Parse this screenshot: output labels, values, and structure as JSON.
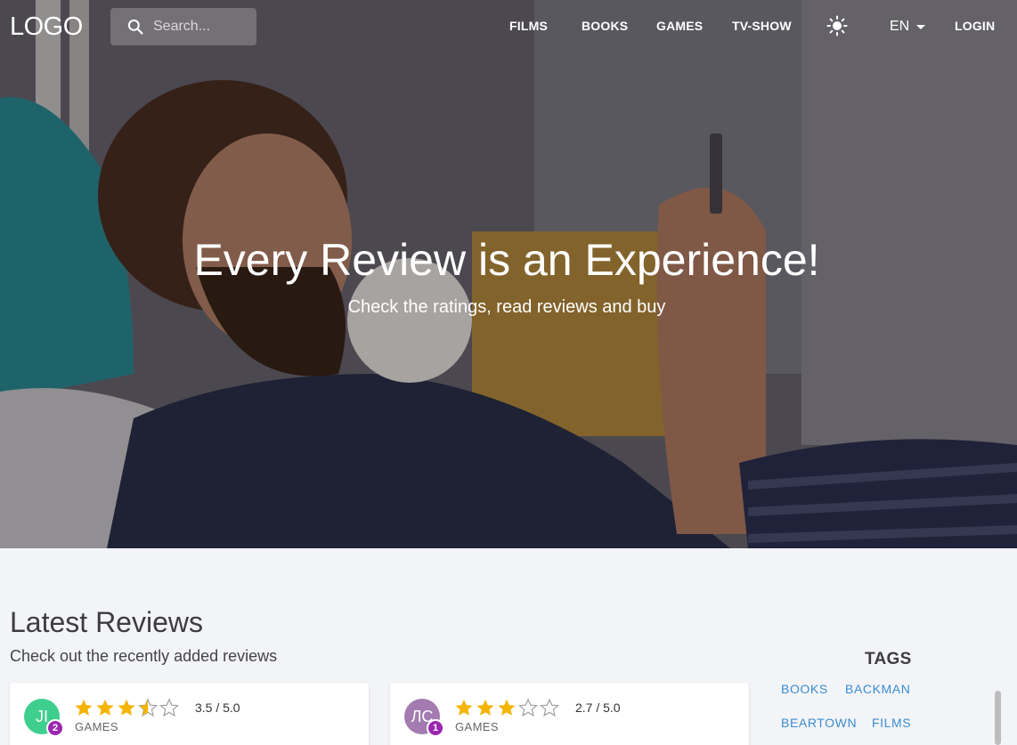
{
  "navbar": {
    "logo": "LOGO",
    "search_placeholder": "Search...",
    "links": [
      "FILMS",
      "BOOKS",
      "GAMES",
      "TV-SHOW"
    ],
    "language": "EN",
    "login": "LOGIN",
    "icons": {
      "search": "search-icon",
      "theme": "sun-icon"
    }
  },
  "hero": {
    "title": "Every Review is an Experience!",
    "subtitle": "Check the ratings, read reviews and buy"
  },
  "latest": {
    "title": "Latest Reviews",
    "subtitle": "Check out the recently added reviews",
    "cards": [
      {
        "initials": "JI",
        "badge": "2",
        "avatar_color": "#3ecf8e",
        "rating": 3.5,
        "rating_text": "3.5 / 5.0",
        "category": "GAMES"
      },
      {
        "initials": "ЛС",
        "badge": "1",
        "avatar_color": "#a37bb0",
        "rating": 2.7,
        "rating_text": "2.7 / 5.0",
        "category": "GAMES"
      }
    ]
  },
  "tags": {
    "title": "TAGS",
    "items": [
      "BOOKS",
      "BACKMAN",
      "BEARTOWN",
      "FILMS"
    ]
  },
  "colors": {
    "star": "#f4b400",
    "star_empty": "#9e9e9e",
    "tag": "#3a8dd1",
    "badge": "#9c27b0"
  }
}
